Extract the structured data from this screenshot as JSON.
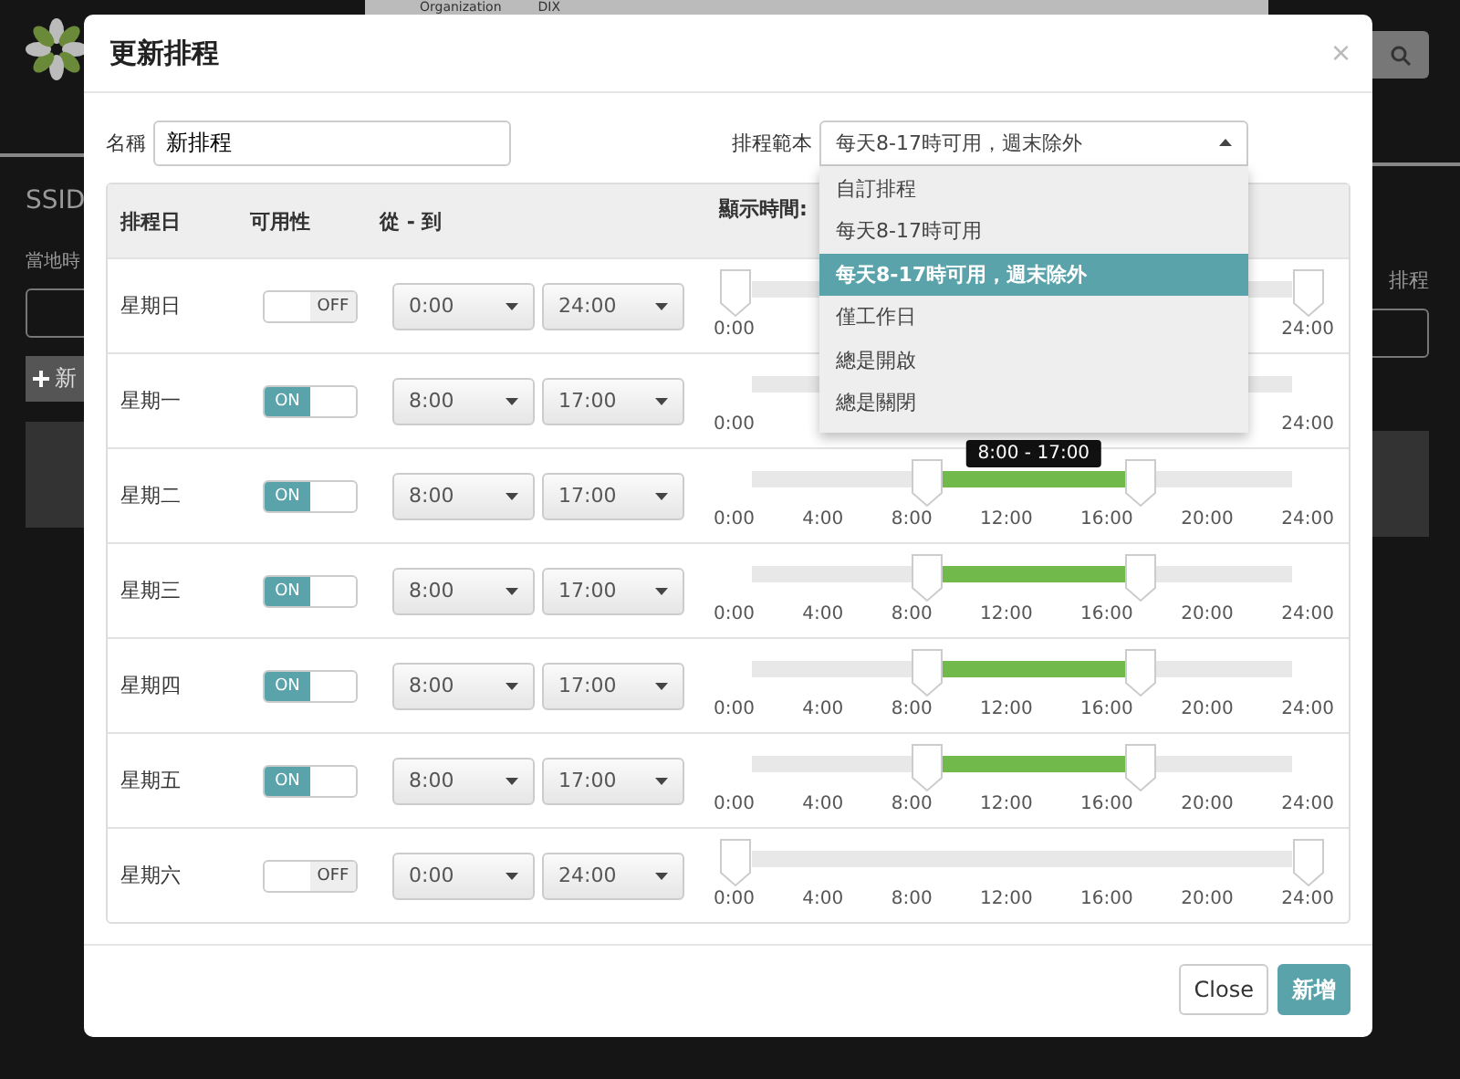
{
  "background": {
    "org_select": {
      "label": "Organization",
      "value": "DIX"
    },
    "ssid_label": "SSID",
    "local_time_label": "當地時",
    "add_button": "新",
    "schedule_label": "排程"
  },
  "dialog": {
    "title": "更新排程",
    "close": "×",
    "name": {
      "label": "名稱",
      "value": "新排程"
    },
    "template": {
      "label": "排程範本",
      "value": "每天8-17時可用，週末除外",
      "expanded": true,
      "options": [
        {
          "label": "自訂排程",
          "selected": false
        },
        {
          "label": "每天8-17時可用",
          "selected": false
        },
        {
          "label": "每天8-17時可用，週末除外",
          "selected": true
        },
        {
          "label": "僅工作日",
          "selected": false
        },
        {
          "label": "總是開啟",
          "selected": false
        },
        {
          "label": "總是關閉",
          "selected": false
        }
      ]
    },
    "table": {
      "columns": [
        "排程日",
        "可用性",
        "從 - 到",
        "顯示時間:"
      ],
      "rows": [
        {
          "day": "星期日",
          "on": false,
          "toggle_label": "OFF",
          "from": "0:00",
          "to": "24:00",
          "slider": {
            "thumbs": [
              {
                "level": 0
              },
              {
                "level": 1
              }
            ],
            "tick_labels": [
              "0:00",
              "24:00"
            ]
          }
        },
        {
          "day": "星期一",
          "on": true,
          "toggle_label": "ON",
          "from": "8:00",
          "to": "17:00",
          "slider": {
            "tick_labels": [
              "0:00",
              "24:00"
            ]
          }
        },
        {
          "day": "星期二",
          "on": true,
          "toggle_label": "ON",
          "from": "8:00",
          "to": "17:00",
          "slider": {
            "thumbs": [
              {
                "level": 0.333
              },
              {
                "level": 0.708
              }
            ],
            "tooltip": "8:00 - 17:00",
            "tick_labels": [
              "0:00",
              "4:00",
              "8:00",
              "12:00",
              "16:00",
              "20:00",
              "24:00"
            ]
          }
        },
        {
          "day": "星期三",
          "on": true,
          "toggle_label": "ON",
          "from": "8:00",
          "to": "17:00",
          "slider": {
            "thumbs": [
              {
                "level": 0.333
              },
              {
                "level": 0.708
              }
            ],
            "tick_labels": [
              "0:00",
              "4:00",
              "8:00",
              "12:00",
              "16:00",
              "20:00",
              "24:00"
            ]
          }
        },
        {
          "day": "星期四",
          "on": true,
          "toggle_label": "ON",
          "from": "8:00",
          "to": "17:00",
          "slider": {
            "thumbs": [
              {
                "level": 0.333
              },
              {
                "level": 0.708
              }
            ],
            "tick_labels": [
              "0:00",
              "4:00",
              "8:00",
              "12:00",
              "16:00",
              "20:00",
              "24:00"
            ]
          }
        },
        {
          "day": "星期五",
          "on": true,
          "toggle_label": "ON",
          "from": "8:00",
          "to": "17:00",
          "slider": {
            "thumbs": [
              {
                "level": 0.333
              },
              {
                "level": 0.708
              }
            ],
            "tick_labels": [
              "0:00",
              "4:00",
              "8:00",
              "12:00",
              "16:00",
              "20:00",
              "24:00"
            ]
          }
        },
        {
          "day": "星期六",
          "on": false,
          "toggle_label": "OFF",
          "from": "0:00",
          "to": "24:00",
          "slider": {
            "thumbs": [
              {
                "level": 0
              },
              {
                "level": 1
              }
            ],
            "tick_labels": [
              "0:00",
              "4:00",
              "8:00",
              "12:00",
              "16:00",
              "20:00",
              "24:00"
            ]
          }
        }
      ]
    },
    "buttons": [
      {
        "label": "Close",
        "kind": "default"
      },
      {
        "label": "新增",
        "kind": "primary"
      }
    ]
  }
}
